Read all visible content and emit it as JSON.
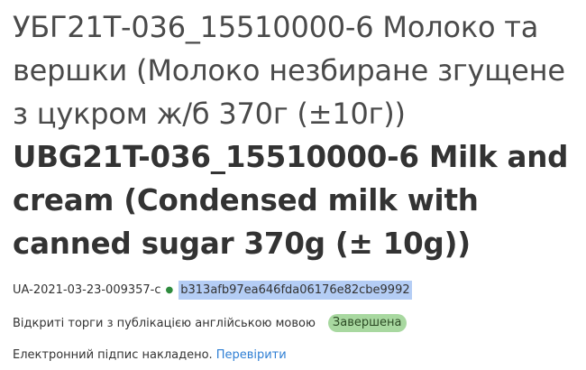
{
  "tender": {
    "title_uk": "УБГ21Т-036_15510000-6 Молоко та вершки (Молоко незбиране згущене з цукром ж/б 370г (±10г))",
    "title_en": "UBG21T-036_15510000-6 Milk and cream (Condensed milk with canned sugar 370g (± 10g))",
    "tender_id": "UA-2021-03-23-009357-c",
    "separator": "●",
    "hash": "b313afb97ea646fda06176e82cbe9992",
    "procedure_type": "Відкриті торги з публікацією англійською мовою",
    "status": "Завершена",
    "signature_text": "Електронний підпис накладено.",
    "verify_link": "Перевірити"
  },
  "colors": {
    "status_badge_bg": "#a8d8a0",
    "hash_highlight": "#b4cdf5",
    "link": "#2f7fd4",
    "separator_dot": "#2e8b3e"
  }
}
